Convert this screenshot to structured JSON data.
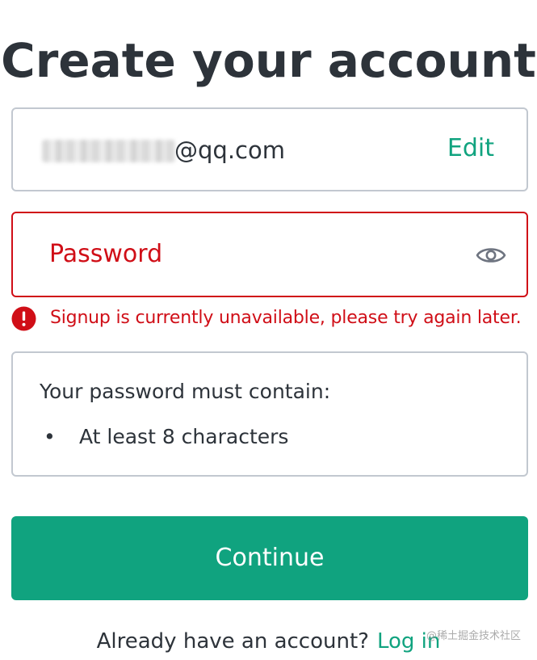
{
  "header": {
    "title": "Create your account"
  },
  "email": {
    "domain": "@qq.com",
    "edit_label": "Edit"
  },
  "password": {
    "placeholder": "Password"
  },
  "error": {
    "message": "Signup is currently unavailable, please try again later.",
    "color": "#d00e17"
  },
  "requirements": {
    "heading": "Your password must contain:",
    "items": [
      {
        "bullet": "•",
        "text": "At least 8 characters"
      }
    ]
  },
  "actions": {
    "continue_label": "Continue",
    "accent_color": "#10a37f"
  },
  "footer": {
    "prompt": "Already have an account?",
    "login_label": "Log in"
  },
  "watermark": {
    "text": "@稀土掘金技术社区"
  },
  "icons": {
    "password_toggle": "eye-icon",
    "error": "alert-circle-icon"
  }
}
